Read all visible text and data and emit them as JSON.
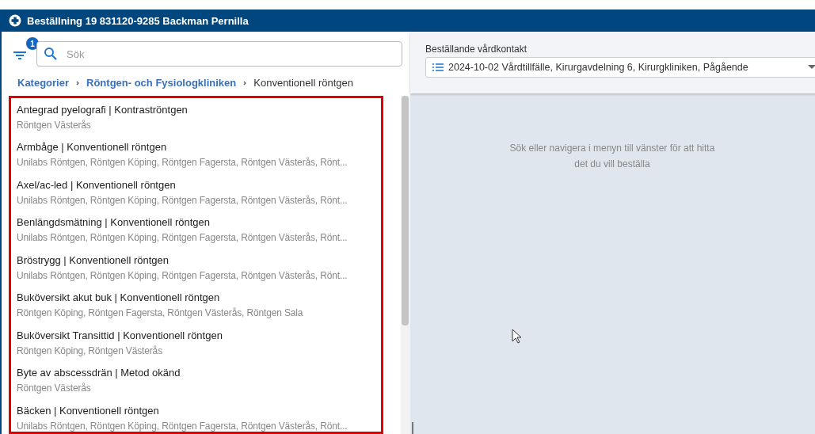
{
  "window": {
    "title": "Beställning 19 831120-9285 Backman Pernilla"
  },
  "filter": {
    "badge": "1"
  },
  "search": {
    "placeholder": "Sök"
  },
  "breadcrumb": [
    {
      "label": "Kategorier",
      "kind": "link"
    },
    {
      "label": "Röntgen- och Fysiologkliniken",
      "kind": "link"
    },
    {
      "label": "Konventionell röntgen",
      "kind": "current"
    }
  ],
  "items": [
    {
      "title": "Antegrad pyelografi | Kontraströntgen",
      "subtitle": "Röntgen Västerås"
    },
    {
      "title": "Armbåge | Konventionell röntgen",
      "subtitle": "Unilabs Röntgen, Röntgen Köping, Röntgen Fagersta, Röntgen Västerås, Rönt..."
    },
    {
      "title": "Axel/ac-led | Konventionell röntgen",
      "subtitle": "Unilabs Röntgen, Röntgen Köping, Röntgen Fagersta, Röntgen Västerås, Rönt..."
    },
    {
      "title": "Benlängdsmätning | Konventionell röntgen",
      "subtitle": "Unilabs Röntgen, Röntgen Köping, Röntgen Fagersta, Röntgen Västerås, Rönt..."
    },
    {
      "title": "Bröstrygg | Konventionell röntgen",
      "subtitle": "Unilabs Röntgen, Röntgen Köping, Röntgen Fagersta, Röntgen Västerås, Rönt..."
    },
    {
      "title": "Buköversikt akut buk | Konventionell röntgen",
      "subtitle": "Röntgen Köping, Röntgen Fagersta, Röntgen Västerås, Röntgen Sala"
    },
    {
      "title": "Buköversikt Transittid | Konventionell röntgen",
      "subtitle": "Röntgen Köping, Röntgen Västerås"
    },
    {
      "title": "Byte av abscessdrän | Metod okänd",
      "subtitle": "Röntgen Västerås"
    },
    {
      "title": "Bäcken | Konventionell röntgen",
      "subtitle": "Unilabs Röntgen, Röntgen Köping, Röntgen Fagersta, Röntgen Västerås, Rönt..."
    }
  ],
  "contact": {
    "label": "Beställande vårdkontakt",
    "value": "2024-10-02 Vårdtillfälle, Kirurgavdelning 6, Kirurgkliniken, Pågående"
  },
  "empty_message": "Sök eller navigera i menyn till vänster för att hitta det du vill beställa"
}
